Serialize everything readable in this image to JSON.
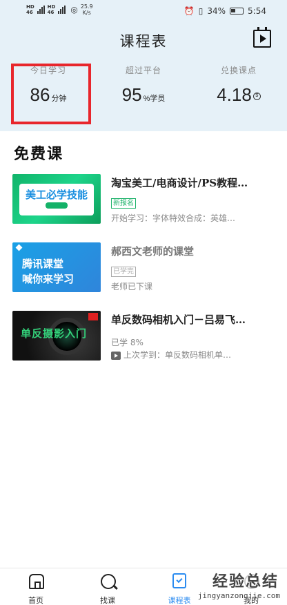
{
  "status_bar": {
    "net_labels": [
      "HD",
      "46",
      "HD",
      "46"
    ],
    "speed": "25.9",
    "speed_unit": "K/s",
    "battery": "34%",
    "time": "5:54"
  },
  "header": {
    "title": "课程表",
    "calendar_icon": "calendar-play-icon"
  },
  "stats": [
    {
      "label": "今日学习",
      "value": "86",
      "unit": "分钟"
    },
    {
      "label": "超过平台",
      "value": "95",
      "unit": "%学员"
    },
    {
      "label": "兑换课点",
      "value": "4.18",
      "unit": ""
    }
  ],
  "highlight_color": "#e8262c",
  "section": {
    "title": "免费课"
  },
  "courses": [
    {
      "title": "淘宝美工/电商设计/PS教程…",
      "badge": "新报名",
      "badge_color": "#1fb36b",
      "subtitle": "开始学习：字体特效合成：英雄…",
      "thumb_text": "美工必学技能"
    },
    {
      "title": "郝西文老师的课堂",
      "badge": "已学完",
      "badge_color": "#aaaaaa",
      "subtitle": "老师已下课",
      "thumb_text_1": "腾讯课堂",
      "thumb_text_2": "喊你来学习"
    },
    {
      "title": "单反数码相机入门－吕易飞…",
      "progress": "已学 8%",
      "progress_value": 0.08,
      "subtitle": "上次学到：单反数码相机单…",
      "thumb_text": "单反摄影入门"
    }
  ],
  "bottom_nav": [
    {
      "label": "首页",
      "icon": "home-icon"
    },
    {
      "label": "找课",
      "icon": "search-icon"
    },
    {
      "label": "课程表",
      "icon": "schedule-icon"
    },
    {
      "label": "我的",
      "icon": "me-icon"
    }
  ],
  "watermark": {
    "text": "经验总结",
    "url": "jingyanzongjie.com"
  },
  "accent": "#2c8cf0"
}
